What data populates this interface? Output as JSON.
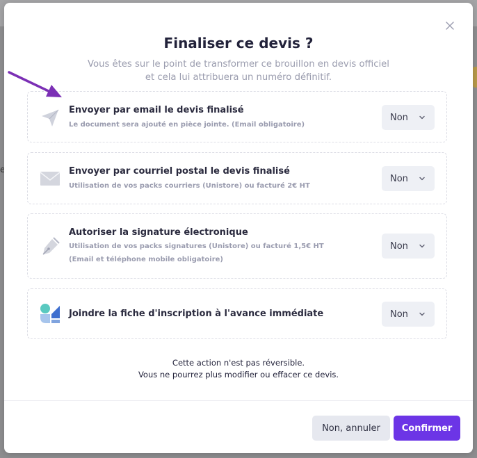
{
  "modal": {
    "title": "Finaliser ce devis ?",
    "subtitle_line1": "Vous êtes sur le point de transformer ce brouillon en devis officiel",
    "subtitle_line2": "et cela lui attribuera un numéro définitif."
  },
  "options": [
    {
      "icon": "paper-plane-icon",
      "title": "Envoyer par email le devis finalisé",
      "desc_line1": "Le document sera ajouté en pièce jointe. (Email obligatoire)",
      "value": "Non"
    },
    {
      "icon": "envelope-icon",
      "title": "Envoyer par courriel postal le devis finalisé",
      "desc_line1": "Utilisation de vos packs courriers (Unistore) ou facturé 2€ HT",
      "value": "Non"
    },
    {
      "icon": "fountain-pen-icon",
      "title": "Autoriser la signature électronique",
      "desc_line1": "Utilisation de vos packs signatures (Unistore) ou facturé 1,5€ HT",
      "desc_line2": "(Email et téléphone mobile obligatoire)",
      "value": "Non"
    },
    {
      "icon": "advance-logo-icon",
      "title": "Joindre la fiche d'inscription à l'avance immédiate",
      "value": "Non"
    }
  ],
  "warning": {
    "line1": "Cette action n'est pas réversible.",
    "line2": "Vous ne pourrez plus modifier ou effacer ce devis."
  },
  "buttons": {
    "cancel": "Non, annuler",
    "confirm": "Confirmer"
  },
  "backdrop": {
    "partial_letter": "e"
  },
  "colors": {
    "primary": "#6c35e6",
    "annotation_arrow": "#7b2fb5",
    "title": "#22223a",
    "muted_text": "#9a9caf"
  }
}
